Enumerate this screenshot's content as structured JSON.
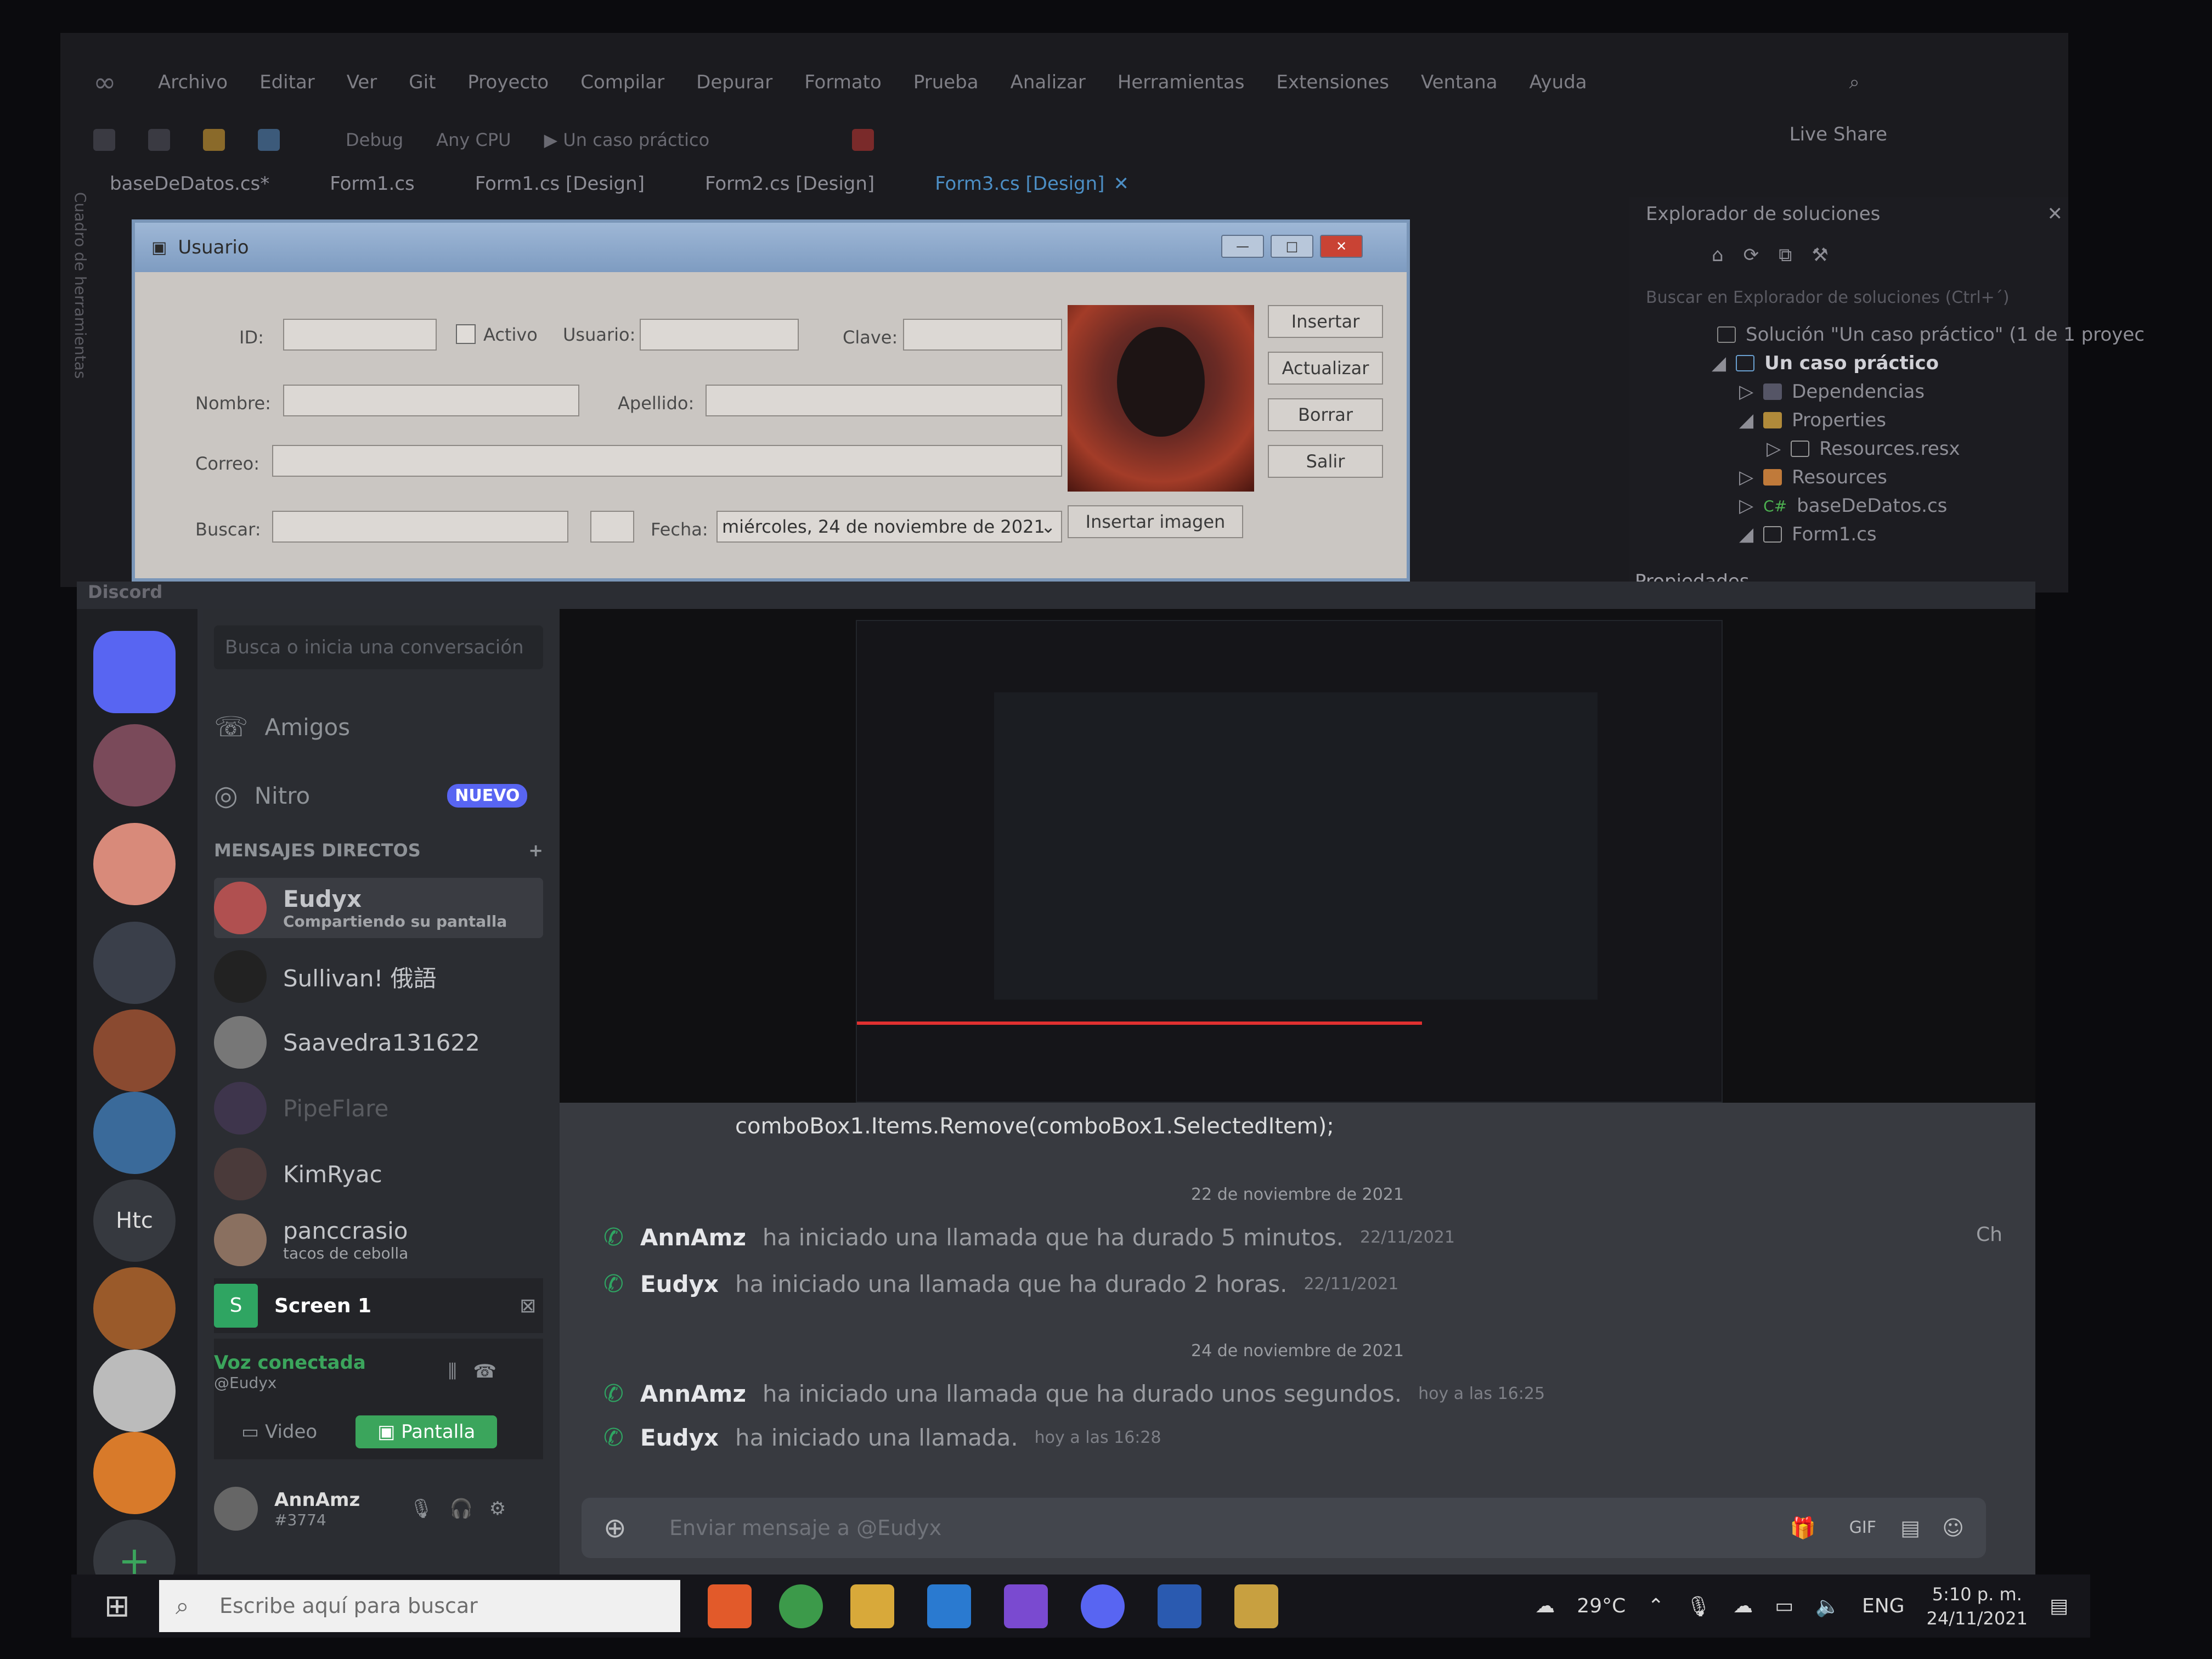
{
  "vs": {
    "menu": [
      "Archivo",
      "Editar",
      "Ver",
      "Git",
      "Proyecto",
      "Compilar",
      "Depurar",
      "Formato",
      "Prueba",
      "Analizar",
      "Herramientas",
      "Extensiones",
      "Ventana",
      "Ayuda"
    ],
    "toolbar": {
      "config": "Debug",
      "platform": "Any CPU",
      "run": "Un caso práctico"
    },
    "live_share": "Live Share",
    "sidebar_label": "Cuadro de herramientas",
    "tabs": [
      "baseDeDatos.cs*",
      "Form1.cs",
      "Form1.cs [Design]",
      "Form2.cs [Design]",
      "Form3.cs [Design]"
    ],
    "active_tab": "Form3.cs [Design]",
    "solution_explorer": {
      "title": "Explorador de soluciones",
      "search_placeholder": "Buscar en Explorador de soluciones (Ctrl+´)",
      "items": [
        "Solución \"Un caso práctico\" (1 de 1 proyec",
        "Un caso práctico",
        "Dependencias",
        "Properties",
        "Resources.resx",
        "Resources",
        "baseDeDatos.cs",
        "Form1.cs"
      ],
      "properties_title": "Propiedades"
    }
  },
  "form": {
    "title": "Usuario",
    "labels": {
      "id": "ID:",
      "activo": "Activo",
      "usuario": "Usuario:",
      "clave": "Clave:",
      "nombre": "Nombre:",
      "apellido": "Apellido:",
      "correo": "Correo:",
      "buscar": "Buscar:",
      "fecha": "Fecha:"
    },
    "fecha_value": "miércoles, 24 de noviembre de 2021",
    "buttons": {
      "insertar": "Insertar",
      "actualizar": "Actualizar",
      "borrar": "Borrar",
      "salir": "Salir",
      "insertar_imagen": "Insertar imagen"
    }
  },
  "discord": {
    "label": "Discord",
    "search_placeholder": "Busca o inicia una conversación",
    "friends": "Amigos",
    "nitro": "Nitro",
    "nitro_badge": "NUEVO",
    "dm_header": "MENSAJES DIRECTOS",
    "server_text": "Htc",
    "dms": [
      {
        "name": "Eudyx",
        "sub": "Compartiendo su pantalla"
      },
      {
        "name": "Sullivan! 俄語",
        "sub": ""
      },
      {
        "name": "Saavedra131622",
        "sub": ""
      },
      {
        "name": "PipeFlare",
        "sub": ""
      },
      {
        "name": "KimRyac",
        "sub": ""
      },
      {
        "name": "panccrasio",
        "sub": "tacos de cebolla"
      }
    ],
    "screen_label": "Screen 1",
    "voice": {
      "status": "Voz conectada",
      "channel": "@Eudyx",
      "video": "Video",
      "screen": "Pantalla"
    },
    "user": {
      "name": "AnnAmz",
      "tag": "#3774"
    },
    "code_line": "comboBox1.Items.Remove(comboBox1.SelectedItem);",
    "sep1": "22 de noviembre de 2021",
    "sep2": "24 de noviembre de 2021",
    "messages": [
      {
        "name": "AnnAmz",
        "text": "ha iniciado una llamada que ha durado 5 minutos.",
        "ts": "22/11/2021"
      },
      {
        "name": "Eudyx",
        "text": "ha iniciado una llamada que ha durado 2 horas.",
        "ts": "22/11/2021"
      },
      {
        "name": "AnnAmz",
        "text": "ha iniciado una llamada que ha durado unos segundos.",
        "ts": "hoy a las 16:25"
      },
      {
        "name": "Eudyx",
        "text": "ha iniciado una llamada.",
        "ts": "hoy a las 16:28"
      }
    ],
    "input_placeholder": "Enviar mensaje a @Eudyx",
    "side_text": "Ch"
  },
  "taskbar": {
    "search_placeholder": "Escribe aquí para buscar",
    "temperature": "29°C",
    "lang": "ENG",
    "time": "5:10 p. m.",
    "date": "24/11/2021"
  }
}
